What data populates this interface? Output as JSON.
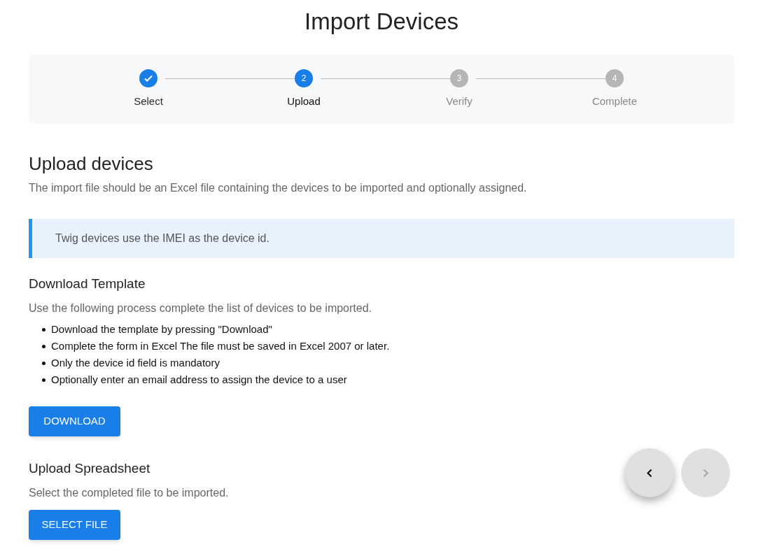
{
  "title": "Import Devices",
  "steps": [
    {
      "label": "Select",
      "completed": true,
      "selected": false
    },
    {
      "number": "2",
      "label": "Upload",
      "completed": false,
      "selected": true
    },
    {
      "number": "3",
      "label": "Verify",
      "completed": false,
      "selected": false
    },
    {
      "number": "4",
      "label": "Complete",
      "completed": false,
      "selected": false
    }
  ],
  "heading": "Upload devices",
  "intro": "The import file should be an Excel file containing the devices to be imported and optionally assigned.",
  "info": "Twig devices use the IMEI as the device id.",
  "template": {
    "heading": "Download Template",
    "text": "Use the following process complete the list of devices to be imported.",
    "items": [
      "Download the template by pressing \"Download\"",
      "Complete the form in Excel The file must be saved in Excel 2007 or later.",
      "Only the device id field is mandatory",
      "Optionally enter an email address to assign the device to a user"
    ],
    "button": "DOWNLOAD"
  },
  "upload": {
    "heading": "Upload Spreadsheet",
    "text": "Select the completed file to be imported.",
    "button": "SELECT FILE"
  },
  "nav": [
    {
      "kind": "back",
      "disabled": false
    },
    {
      "kind": "next",
      "disabled": true
    }
  ]
}
